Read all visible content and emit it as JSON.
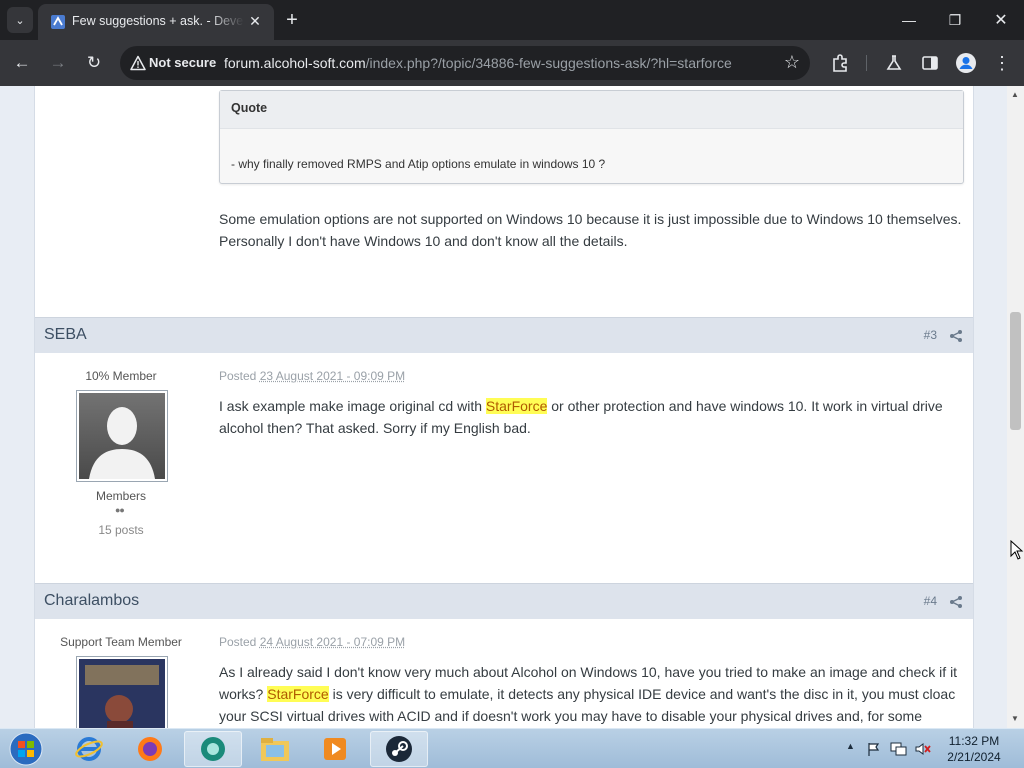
{
  "browser": {
    "tab_title": "Few suggestions + ask. - Devel",
    "security_label": "Not secure",
    "url_host": "forum.alcohol-soft.com",
    "url_path": "/index.php?/topic/34886-few-suggestions-ask/?hl=starforce"
  },
  "quote": {
    "header": "Quote",
    "text": "- why finally removed RMPS and Atip options emulate in windows 10 ?"
  },
  "reply": {
    "line1": "Some emulation options are not supported on Windows 10 because it is just impossible due to Windows 10 themselves.",
    "line2": "Personally I don't have Windows 10 and don't know all the details."
  },
  "posts": [
    {
      "author": "SEBA",
      "number": "#3",
      "rank": "10% Member",
      "group": "Members",
      "post_count": "15 posts",
      "posted_label": "Posted",
      "date": "23 August 2021 - 09:09 PM",
      "line1_before": "I ask example make image original cd with",
      "line1_highlight": "StarForce",
      "line1_after": "or other protection and have windows 10. It work in virtual drive",
      "line2": "alcohol then? That asked. Sorry if my English bad."
    },
    {
      "author": "Charalambos",
      "number": "#4",
      "rank": "Support Team Member",
      "posted_label": "Posted",
      "date": "24 August 2021 - 07:09 PM",
      "line1": "As I already said I don't know very much about Alcohol on Windows 10, have you tried to make an image and check if it",
      "line2_before": "works?",
      "line2_highlight": "StarForce",
      "line2_after": "is very difficult to emulate, it detects any physical IDE device and want's the disc in it, you must cloac",
      "line3": "your SCSI virtual drives with ACID and if doesn't work you may have to disable your physical drives and, for some"
    }
  ],
  "taskbar": {
    "time": "11:32 PM",
    "date": "2/21/2024"
  },
  "colors": {
    "highlight": "#fffd55",
    "post_header": "#dde3ec",
    "browser_frame": "#202124"
  }
}
